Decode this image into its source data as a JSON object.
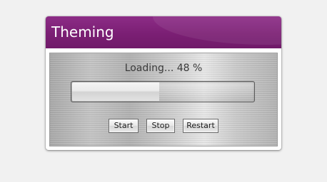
{
  "window": {
    "title": "Theming",
    "accent_color": "#7b1f74"
  },
  "status": {
    "text": "Loading... 48 %"
  },
  "progress": {
    "value": 0.48
  },
  "buttons": {
    "start": "Start",
    "stop": "Stop",
    "restart": "Restart"
  }
}
